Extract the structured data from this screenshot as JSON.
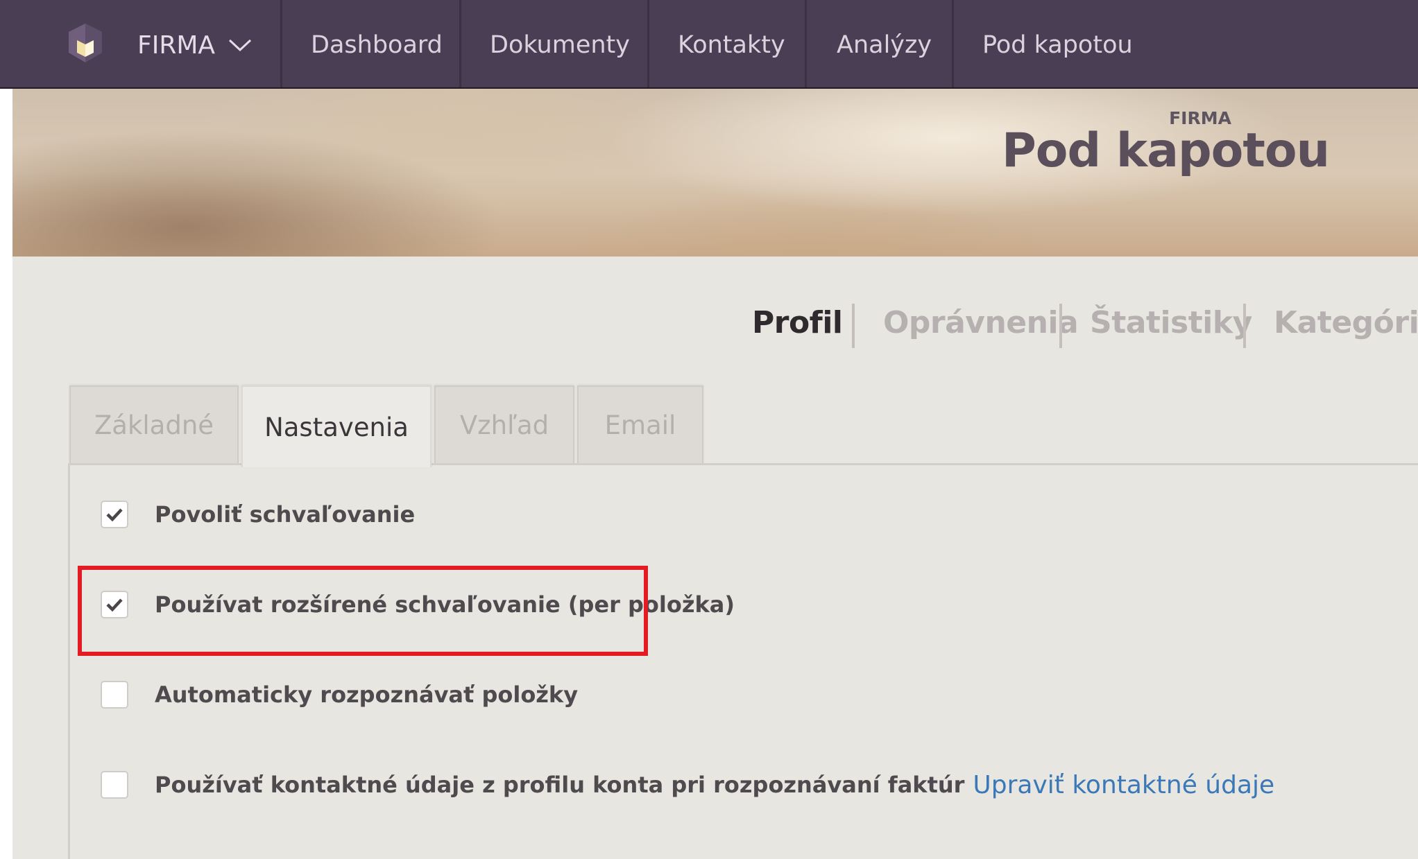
{
  "navbar": {
    "brand_icon": "firma-logo-icon",
    "company_label": "FIRMA",
    "items": [
      "Dashboard",
      "Dokumenty",
      "Kontakty",
      "Analýzy",
      "Pod kapotou"
    ]
  },
  "hero": {
    "title": "Pod kapotou",
    "subtitle": "FIRMA"
  },
  "section_tabs": [
    {
      "label": "Profil",
      "active": true
    },
    {
      "label": "Oprávnenia",
      "active": false
    },
    {
      "label": "Štatistiky",
      "active": false
    },
    {
      "label": "Kategórie",
      "active": false
    }
  ],
  "tabs": [
    {
      "label": "Základné",
      "active": false
    },
    {
      "label": "Nastavenia",
      "active": true
    },
    {
      "label": "Vzhľad",
      "active": false
    },
    {
      "label": "Email",
      "active": false
    }
  ],
  "settings": [
    {
      "label": "Povoliť schvaľovanie",
      "checked": true
    },
    {
      "label": "Používat rozšírené schvaľovanie (per položka)",
      "checked": true
    },
    {
      "label": "Automaticky rozpoznávať položky",
      "checked": false
    },
    {
      "label": "Používať kontaktné údaje z profilu konta pri rozpoznávaní faktúr",
      "checked": false,
      "link": "Upraviť kontaktné údaje"
    }
  ],
  "colors": {
    "navbar_bg": "#4a3e54",
    "highlight": "#e41b23",
    "link": "#3a78b8"
  }
}
